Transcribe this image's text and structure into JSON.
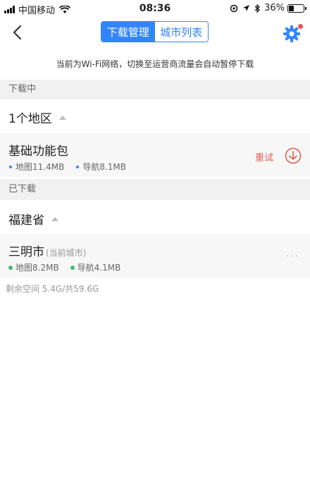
{
  "status_bar": {
    "carrier": "中国移动",
    "time": "08:36",
    "battery": "36%"
  },
  "nav": {
    "tab_download_manage": "下载管理",
    "tab_city_list": "城市列表",
    "active_tab": "下载管理"
  },
  "notice": "当前为Wi-Fi网络，切换至运营商流量会自动暂停下载",
  "downloading": {
    "section_title": "下载中",
    "region_label": "1个地区",
    "item": {
      "name": "基础功能包",
      "map_size": "地图11.4MB",
      "nav_size": "导航8.1MB",
      "retry_label": "重试"
    }
  },
  "downloaded": {
    "section_title": "已下载",
    "province": "福建省",
    "item": {
      "name": "三明市",
      "hint": "(当前城市)",
      "map_size": "地图8.2MB",
      "nav_size": "导航4.1MB",
      "more_label": "···"
    }
  },
  "storage": "剩余空间 5.4G/共59.6G",
  "colors": {
    "accent": "#3385ff",
    "retry": "#e05a4f",
    "downloaded_dot": "#3bbf6a"
  }
}
